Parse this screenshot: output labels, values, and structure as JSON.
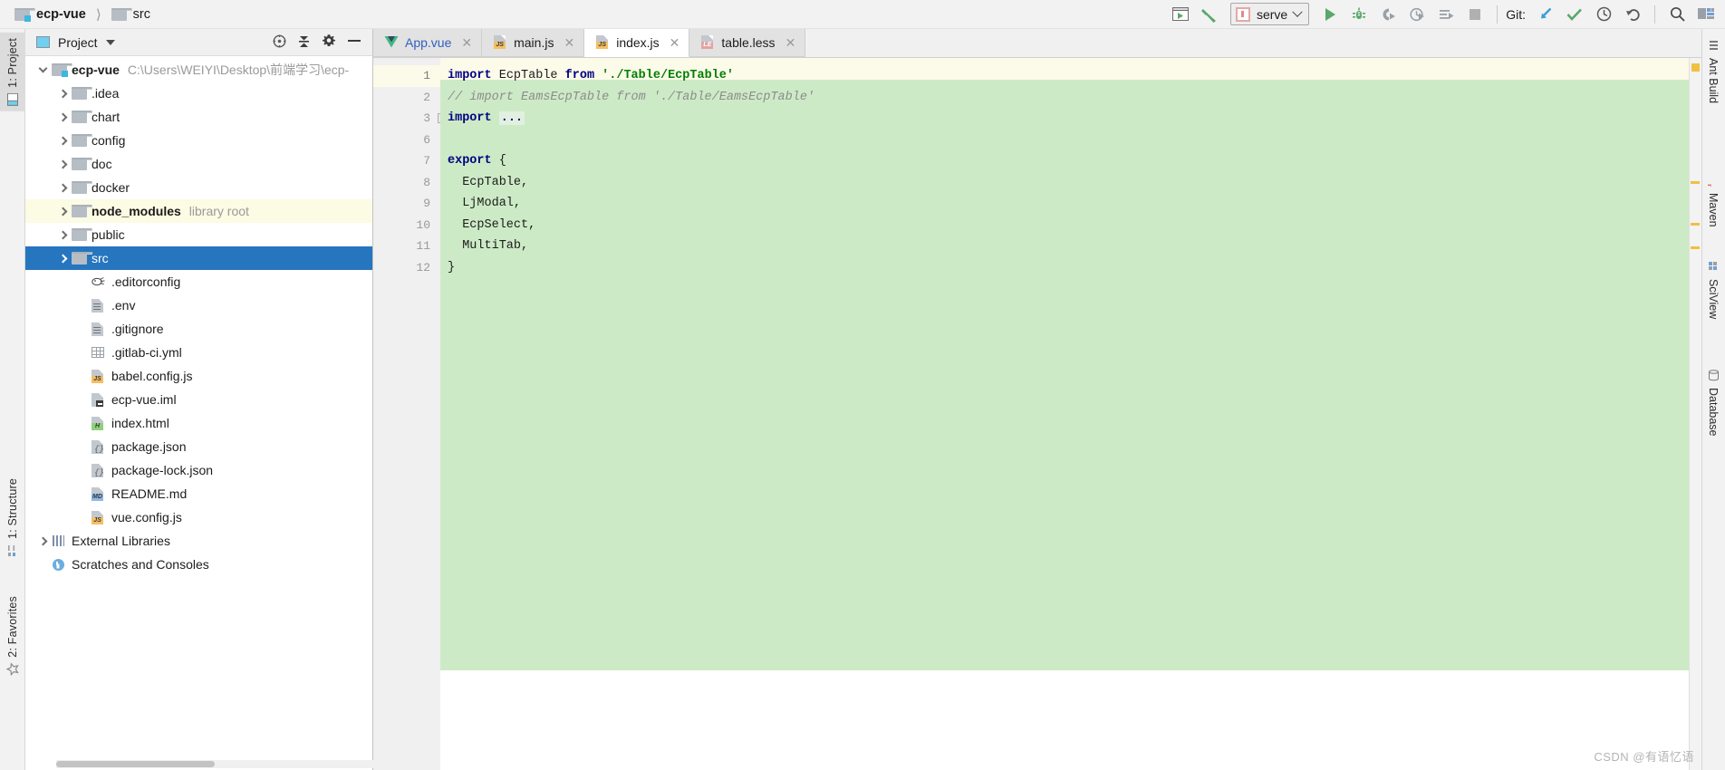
{
  "breadcrumb": {
    "project": "ecp-vue",
    "child": "src"
  },
  "toolbar": {
    "run_config_label": "serve",
    "git_label": "Git:",
    "buttons": [
      {
        "name": "open-terminal-icon",
        "title": "Terminal"
      },
      {
        "name": "build-hammer-icon",
        "title": "Build"
      },
      {
        "name": "run-icon",
        "title": "Run"
      },
      {
        "name": "debug-icon",
        "title": "Debug"
      },
      {
        "name": "run-coverage-icon",
        "title": "Run with Coverage"
      },
      {
        "name": "profile-icon",
        "title": "Profile"
      },
      {
        "name": "run-with-test-icon",
        "title": "Run Tests"
      },
      {
        "name": "stop-icon",
        "title": "Stop"
      },
      {
        "name": "git-update-icon",
        "title": "Update Project"
      },
      {
        "name": "git-commit-icon",
        "title": "Commit"
      },
      {
        "name": "git-history-icon",
        "title": "History"
      },
      {
        "name": "git-rollback-icon",
        "title": "Rollback"
      },
      {
        "name": "search-everywhere-icon",
        "title": "Search Everywhere"
      },
      {
        "name": "layout-icon",
        "title": "Layout"
      }
    ]
  },
  "left_rail": [
    {
      "label": "1: Project",
      "icon": "project-icon",
      "selected": true
    },
    {
      "label": "1: Structure",
      "icon": "structure-icon",
      "selected": false
    },
    {
      "label": "2: Favorites",
      "icon": "favorites-icon",
      "selected": false
    }
  ],
  "right_rail": [
    {
      "label": "Ant Build",
      "icon": "ant-icon"
    },
    {
      "label": "Maven",
      "icon": "maven-icon"
    },
    {
      "label": "SciView",
      "icon": "sciview-icon"
    },
    {
      "label": "Database",
      "icon": "database-icon"
    }
  ],
  "project_panel": {
    "title": "Project",
    "tools": [
      {
        "name": "scroll-from-source-icon"
      },
      {
        "name": "collapse-all-icon"
      },
      {
        "name": "settings-gear-icon"
      },
      {
        "name": "hide-panel-icon"
      }
    ],
    "tree": [
      {
        "name": "ecp-vue",
        "sub": "C:\\Users\\WEIYI\\Desktop\\前端学习\\ecp-",
        "type": "module",
        "depth": 0,
        "arrow": "open",
        "bold": true,
        "state": "none"
      },
      {
        "name": ".idea",
        "sub": "",
        "type": "folder",
        "depth": 1,
        "arrow": "closed",
        "bold": false,
        "state": "none"
      },
      {
        "name": "chart",
        "sub": "",
        "type": "folder",
        "depth": 1,
        "arrow": "closed",
        "bold": false,
        "state": "none"
      },
      {
        "name": "config",
        "sub": "",
        "type": "folder",
        "depth": 1,
        "arrow": "closed",
        "bold": false,
        "state": "none"
      },
      {
        "name": "doc",
        "sub": "",
        "type": "folder",
        "depth": 1,
        "arrow": "closed",
        "bold": false,
        "state": "none"
      },
      {
        "name": "docker",
        "sub": "",
        "type": "folder",
        "depth": 1,
        "arrow": "closed",
        "bold": false,
        "state": "none"
      },
      {
        "name": "node_modules",
        "sub": "library root",
        "type": "folder",
        "depth": 1,
        "arrow": "closed",
        "bold": true,
        "state": "hl"
      },
      {
        "name": "public",
        "sub": "",
        "type": "folder",
        "depth": 1,
        "arrow": "closed",
        "bold": false,
        "state": "none"
      },
      {
        "name": "src",
        "sub": "",
        "type": "folder",
        "depth": 1,
        "arrow": "closed",
        "bold": false,
        "state": "selected"
      },
      {
        "name": ".editorconfig",
        "sub": "",
        "type": "editorconfig",
        "depth": 2,
        "arrow": "none",
        "bold": false,
        "state": "none"
      },
      {
        "name": ".env",
        "sub": "",
        "type": "text",
        "depth": 2,
        "arrow": "none",
        "bold": false,
        "state": "none"
      },
      {
        "name": ".gitignore",
        "sub": "",
        "type": "text",
        "depth": 2,
        "arrow": "none",
        "bold": false,
        "state": "none"
      },
      {
        "name": ".gitlab-ci.yml",
        "sub": "",
        "type": "yaml",
        "depth": 2,
        "arrow": "none",
        "bold": false,
        "state": "none"
      },
      {
        "name": "babel.config.js",
        "sub": "",
        "type": "js",
        "depth": 2,
        "arrow": "none",
        "bold": false,
        "state": "none"
      },
      {
        "name": "ecp-vue.iml",
        "sub": "",
        "type": "iml",
        "depth": 2,
        "arrow": "none",
        "bold": false,
        "state": "none"
      },
      {
        "name": "index.html",
        "sub": "",
        "type": "html",
        "depth": 2,
        "arrow": "none",
        "bold": false,
        "state": "none"
      },
      {
        "name": "package.json",
        "sub": "",
        "type": "json",
        "depth": 2,
        "arrow": "none",
        "bold": false,
        "state": "none"
      },
      {
        "name": "package-lock.json",
        "sub": "",
        "type": "json",
        "depth": 2,
        "arrow": "none",
        "bold": false,
        "state": "none"
      },
      {
        "name": "README.md",
        "sub": "",
        "type": "md",
        "depth": 2,
        "arrow": "none",
        "bold": false,
        "state": "none"
      },
      {
        "name": "vue.config.js",
        "sub": "",
        "type": "js",
        "depth": 2,
        "arrow": "none",
        "bold": false,
        "state": "none"
      },
      {
        "name": "External Libraries",
        "sub": "",
        "type": "library",
        "depth": 0,
        "arrow": "closed",
        "bold": false,
        "state": "none"
      },
      {
        "name": "Scratches and Consoles",
        "sub": "",
        "type": "scratch",
        "depth": 0,
        "arrow": "none",
        "bold": false,
        "state": "none"
      }
    ]
  },
  "editor": {
    "tabs": [
      {
        "label": "App.vue",
        "type": "vue",
        "active": false,
        "closable": true
      },
      {
        "label": "main.js",
        "type": "js",
        "active": false,
        "closable": true
      },
      {
        "label": "index.js",
        "type": "js",
        "active": true,
        "closable": true
      },
      {
        "label": "table.less",
        "type": "less",
        "active": false,
        "closable": true
      }
    ],
    "lines": [
      {
        "num": "1",
        "current": true,
        "folded": false,
        "segments": [
          {
            "t": "import ",
            "c": "kw"
          },
          {
            "t": "EcpTable ",
            "c": "plain"
          },
          {
            "t": "from ",
            "c": "kw"
          },
          {
            "t": "'./Table/EcpTable'",
            "c": "str"
          }
        ]
      },
      {
        "num": "2",
        "current": false,
        "folded": false,
        "segments": [
          {
            "t": "// import EamsEcpTable from './Table/EamsEcpTable'",
            "c": "cmt"
          }
        ]
      },
      {
        "num": "3",
        "current": false,
        "folded": true,
        "segments": [
          {
            "t": "import ",
            "c": "kw"
          },
          {
            "t": "...",
            "c": "fold"
          }
        ]
      },
      {
        "num": "6",
        "current": false,
        "folded": false,
        "segments": [
          {
            "t": "",
            "c": "plain"
          }
        ]
      },
      {
        "num": "7",
        "current": false,
        "folded": false,
        "segments": [
          {
            "t": "export ",
            "c": "kw"
          },
          {
            "t": "{",
            "c": "plain"
          }
        ]
      },
      {
        "num": "8",
        "current": false,
        "folded": false,
        "segments": [
          {
            "t": "  EcpTable,",
            "c": "plain"
          }
        ]
      },
      {
        "num": "9",
        "current": false,
        "folded": false,
        "segments": [
          {
            "t": "  LjModal,",
            "c": "plain"
          }
        ]
      },
      {
        "num": "10",
        "current": false,
        "folded": false,
        "segments": [
          {
            "t": "  EcpSelect,",
            "c": "plain"
          }
        ]
      },
      {
        "num": "11",
        "current": false,
        "folded": false,
        "segments": [
          {
            "t": "  MultiTab,",
            "c": "plain"
          }
        ]
      },
      {
        "num": "12",
        "current": false,
        "folded": false,
        "segments": [
          {
            "t": "}",
            "c": "plain"
          }
        ]
      }
    ]
  },
  "watermark": "CSDN @有语忆语",
  "colors": {
    "selection_blue": "#2675bf",
    "highlight_yellow": "#fcfbe3",
    "code_green": "#cdeac6",
    "caret_line": "#fcfae8",
    "accent_green": "#4a9a4a",
    "string_green": "#008000",
    "keyword_navy": "#000080"
  }
}
